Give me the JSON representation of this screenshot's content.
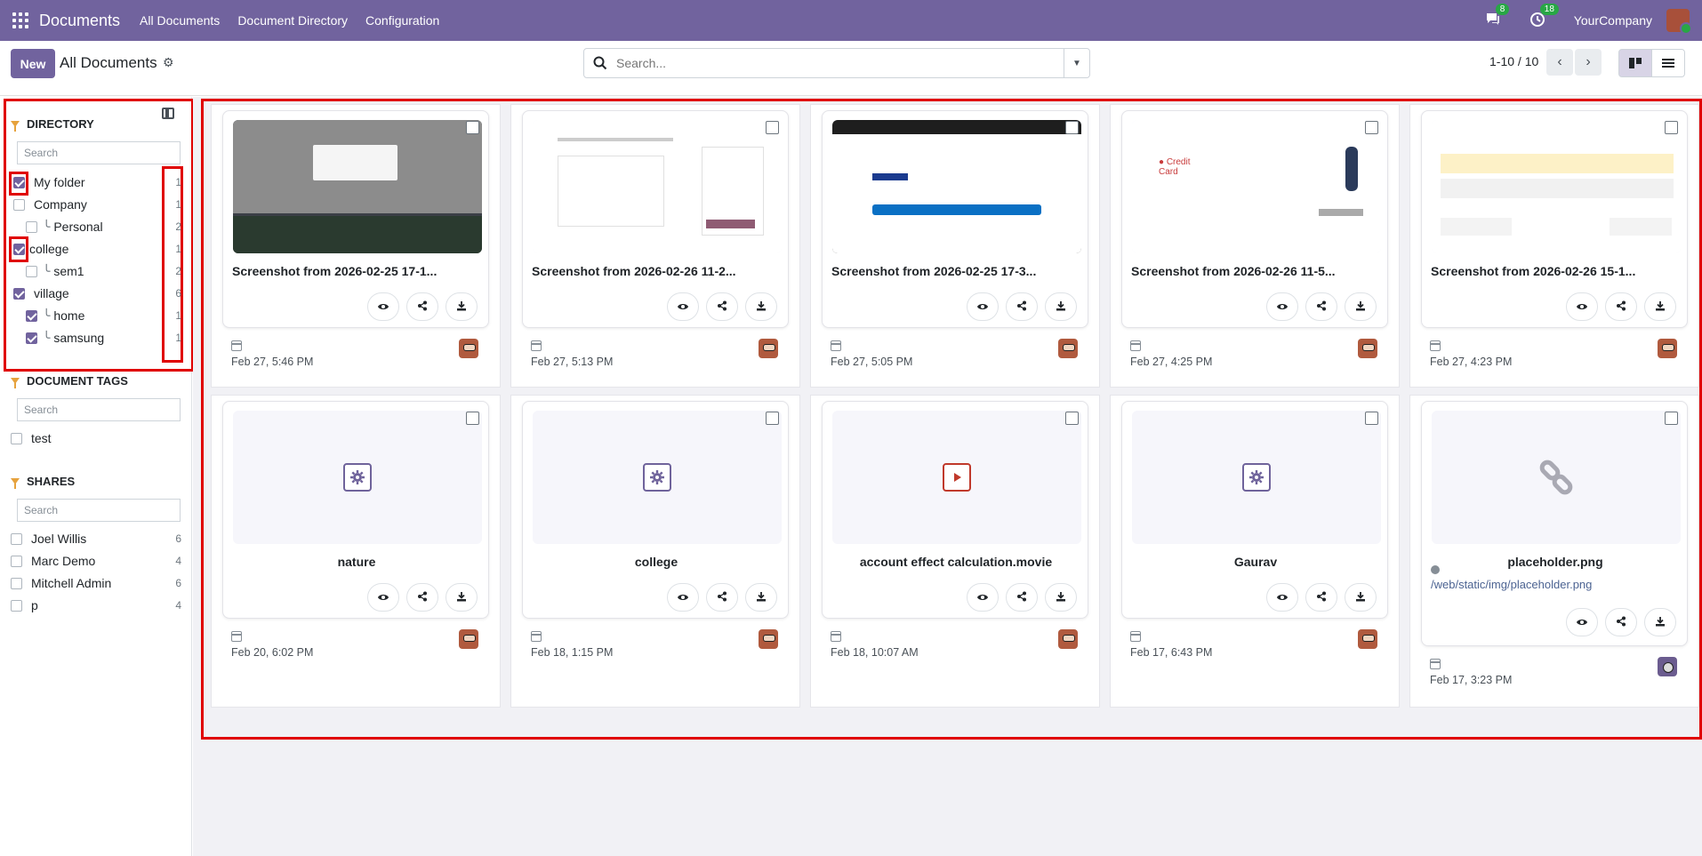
{
  "topbar": {
    "app_title": "Documents",
    "menu": [
      "All Documents",
      "Document Directory",
      "Configuration"
    ],
    "messages_badge": "8",
    "activity_badge": "18",
    "company": "YourCompany"
  },
  "control_panel": {
    "new_label": "New",
    "breadcrumb": "All Documents",
    "search_placeholder": "Search...",
    "pager": "1-10 / 10"
  },
  "sidebar": {
    "directory": {
      "title": "DIRECTORY",
      "search_placeholder": "Search",
      "items": [
        {
          "label": "My folder",
          "count": "1",
          "checked": true
        },
        {
          "label": "Company",
          "count": "1",
          "checked": false
        },
        {
          "label": "Personal",
          "count": "2",
          "checked": false
        },
        {
          "label": "college",
          "count": "1",
          "checked": true
        },
        {
          "label": "sem1",
          "count": "2",
          "checked": false
        },
        {
          "label": "village",
          "count": "6",
          "checked": true
        },
        {
          "label": "home",
          "count": "1",
          "checked": true
        },
        {
          "label": "samsung",
          "count": "1",
          "checked": true
        }
      ]
    },
    "tags": {
      "title": "DOCUMENT TAGS",
      "search_placeholder": "Search",
      "items": [
        {
          "label": "test"
        }
      ]
    },
    "shares": {
      "title": "SHARES",
      "search_placeholder": "Search",
      "items": [
        {
          "label": "Joel Willis",
          "count": "6"
        },
        {
          "label": "Marc Demo",
          "count": "4"
        },
        {
          "label": "Mitchell Admin",
          "count": "6"
        },
        {
          "label": "p",
          "count": "4"
        }
      ]
    }
  },
  "cards": [
    {
      "name": "Screenshot from 2026-02-25 17-1...",
      "date": "Feb 27, 5:46 PM",
      "kind": "screenshot"
    },
    {
      "name": "Screenshot from 2026-02-26 11-2...",
      "date": "Feb 27, 5:13 PM",
      "kind": "screenshot"
    },
    {
      "name": "Screenshot from 2026-02-25 17-3...",
      "date": "Feb 27, 5:05 PM",
      "kind": "screenshot"
    },
    {
      "name": "Screenshot from 2026-02-26 11-5...",
      "date": "Feb 27, 4:25 PM",
      "kind": "screenshot"
    },
    {
      "name": "Screenshot from 2026-02-26 15-1...",
      "date": "Feb 27, 4:23 PM",
      "kind": "screenshot"
    },
    {
      "name": "nature",
      "date": "Feb 20, 6:02 PM",
      "kind": "gear"
    },
    {
      "name": "college",
      "date": "Feb 18, 1:15 PM",
      "kind": "gear"
    },
    {
      "name": "account effect calculation.movie",
      "date": "Feb 18, 10:07 AM",
      "kind": "video"
    },
    {
      "name": "Gaurav",
      "date": "Feb 17, 6:43 PM",
      "kind": "gear"
    },
    {
      "name": "placeholder.png",
      "date": "Feb 17, 3:23 PM",
      "kind": "link",
      "url": "/web/static/img/placeholder.png"
    }
  ],
  "colors": {
    "brand": "#71639e",
    "highlight": "#e00000"
  }
}
